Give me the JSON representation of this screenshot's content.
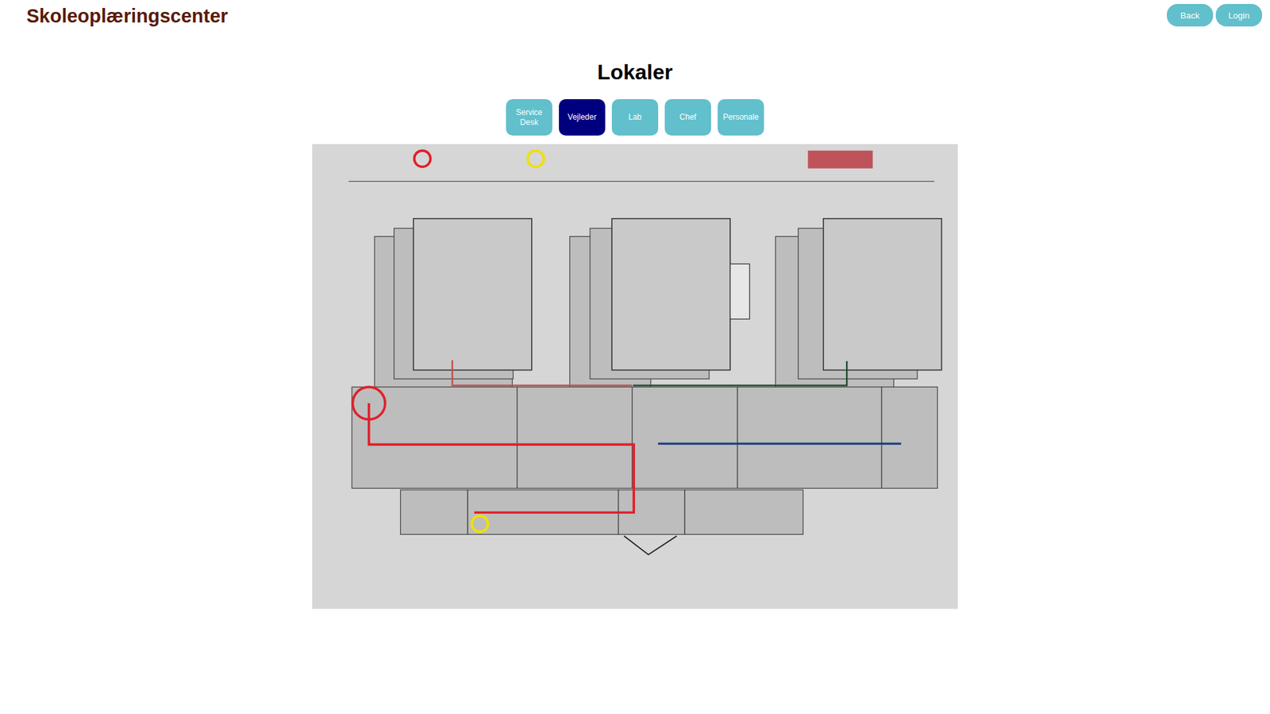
{
  "header": {
    "title": "Skoleoplæringscenter",
    "buttons": [
      "Back",
      "Login"
    ]
  },
  "page": {
    "heading": "Lokaler"
  },
  "tabs": [
    {
      "label": "Service Desk",
      "selected": false
    },
    {
      "label": "Vejleder",
      "selected": true
    },
    {
      "label": "Lab",
      "selected": false
    },
    {
      "label": "Chef",
      "selected": false
    },
    {
      "label": "Personale",
      "selected": false
    }
  ]
}
